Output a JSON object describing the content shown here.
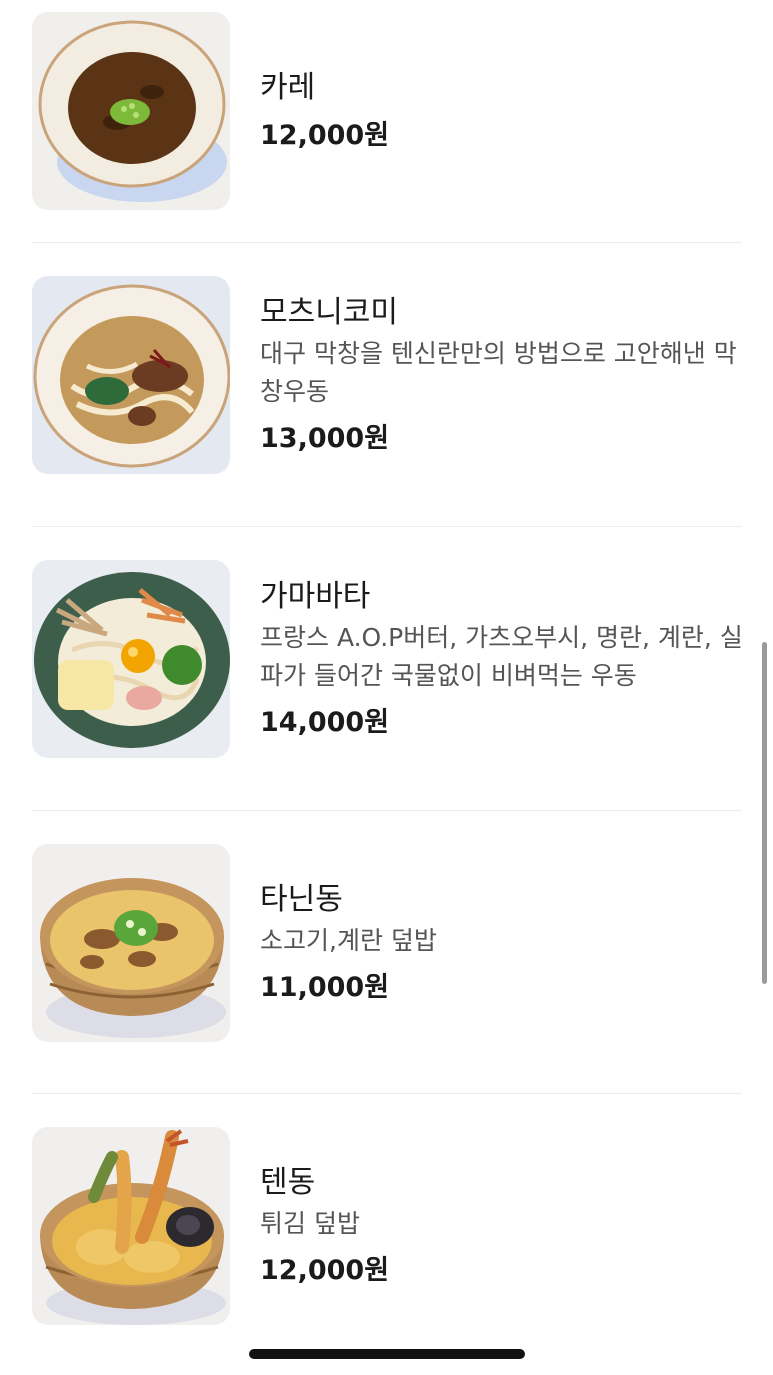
{
  "menu": {
    "items": [
      {
        "name": "카레",
        "description": "",
        "price": "12,000원",
        "image_icon": "curry-udon-photo"
      },
      {
        "name": "모츠니코미",
        "description": "대구 막창을 텐신란만의 방법으로 고안해낸 막창우동",
        "price": "13,000원",
        "image_icon": "motsunikomi-udon-photo"
      },
      {
        "name": "가마바타",
        "description": "프랑스 A.O.P버터, 가츠오부시, 명란, 계란, 실파가 들어간 국물없이 비벼먹는 우동",
        "price": "14,000원",
        "image_icon": "kamabata-udon-photo"
      },
      {
        "name": "타닌동",
        "description": "소고기,계란 덮밥",
        "price": "11,000원",
        "image_icon": "tanindon-photo"
      },
      {
        "name": "텐동",
        "description": "튀김 덮밥",
        "price": "12,000원",
        "image_icon": "tendon-photo"
      }
    ]
  }
}
